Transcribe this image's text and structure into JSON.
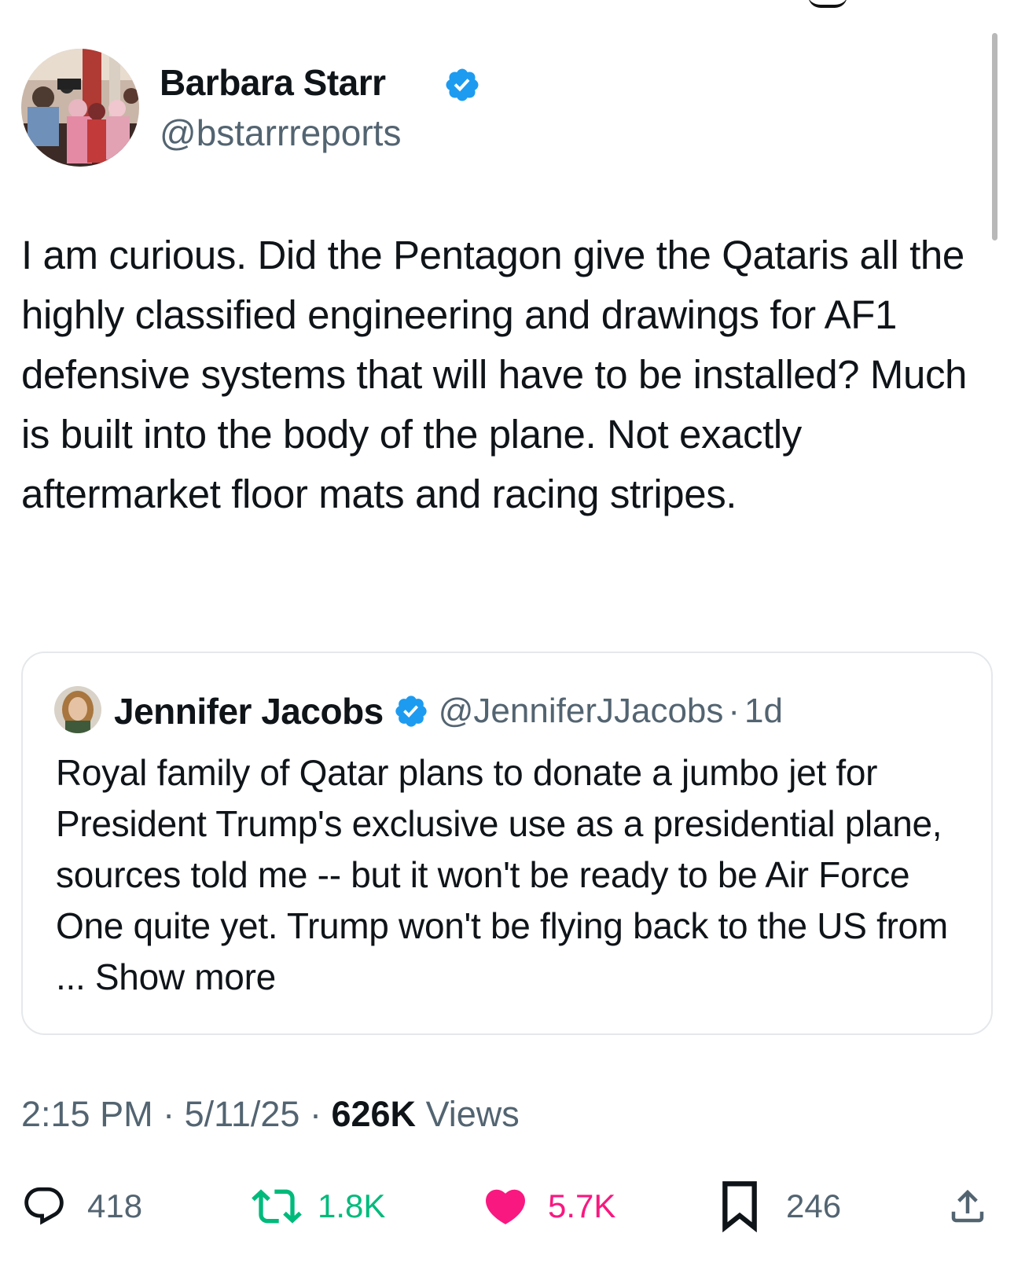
{
  "tweet": {
    "author": {
      "name": "Barbara Starr",
      "handle": "@bstarrreports",
      "verified": true
    },
    "text": "I am curious. Did the Pentagon give the Qataris all the highly classified engineering and drawings for AF1 defensive systems that will have to be installed? Much is built into the body of the plane. Not exactly aftermarket floor mats and racing stripes.",
    "quoted": {
      "name": "Jennifer Jacobs",
      "handle": "@JenniferJJacobs",
      "separator": "·",
      "time": "1d",
      "text": "Royal family of Qatar plans to donate a jumbo jet for President Trump's exclusive use as a presidential plane, sources told me -- but it won't be ready to be Air Force One quite yet. Trump won't be flying back to the US from ... Show more"
    },
    "meta": {
      "time": "2:15 PM",
      "separator": "·",
      "date": "5/11/25",
      "views_count": "626K",
      "views_label": "Views"
    },
    "actions": {
      "replies": "418",
      "reposts": "1.8K",
      "likes": "5.7K",
      "bookmarks": "246"
    }
  },
  "icons": {
    "verified": "verified-badge-icon",
    "reply": "reply-icon",
    "repost": "repost-icon",
    "like": "heart-icon",
    "bookmark": "bookmark-icon",
    "share": "share-icon"
  },
  "colors": {
    "verified_blue": "#1d9bf0",
    "text_primary": "#0f1419",
    "text_secondary": "#536471",
    "repost_green": "#00ba7c",
    "like_pink": "#f91880",
    "border": "#e5e8eb"
  }
}
